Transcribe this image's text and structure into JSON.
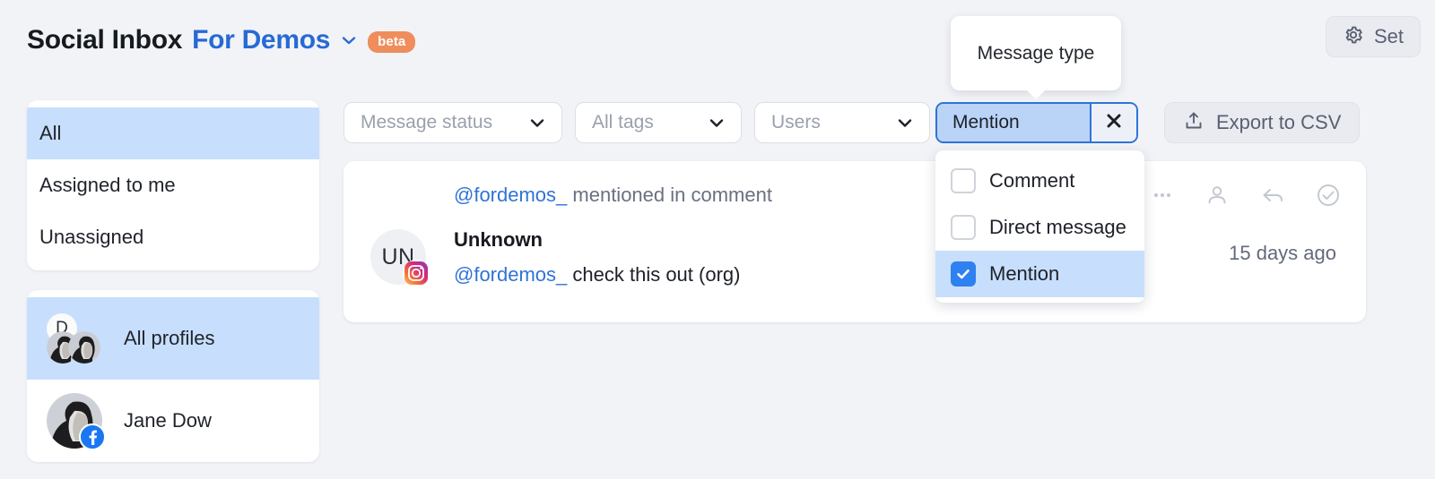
{
  "header": {
    "app_title": "Social Inbox",
    "workspace": "For Demos",
    "workspace_caret_icon": "chevron-down-icon",
    "badge": "beta",
    "settings_label": "Set",
    "settings_icon": "gear-icon"
  },
  "sidebar": {
    "scope_items": [
      {
        "label": "All",
        "active": true
      },
      {
        "label": "Assigned to me",
        "active": false
      },
      {
        "label": "Unassigned",
        "active": false
      }
    ],
    "profiles": [
      {
        "label": "All profiles",
        "active": true,
        "avatar": "avatar-cluster",
        "badge_letter": "D"
      },
      {
        "label": "Jane Dow",
        "active": false,
        "avatar": "portrait",
        "network": "facebook"
      }
    ]
  },
  "filters": {
    "message_status": {
      "placeholder": "Message status",
      "icon": "chevron-down-icon"
    },
    "all_tags": {
      "placeholder": "All tags",
      "icon": "chevron-down-icon"
    },
    "users": {
      "placeholder": "Users",
      "icon": "chevron-down-icon"
    },
    "message_type": {
      "value": "Mention",
      "clear_icon": "close-icon",
      "tooltip": "Message type",
      "options": [
        {
          "label": "Comment",
          "checked": false
        },
        {
          "label": "Direct message",
          "checked": false
        },
        {
          "label": "Mention",
          "checked": true
        }
      ]
    },
    "export": {
      "label": "Export to CSV",
      "icon": "upload-icon"
    }
  },
  "message": {
    "meta_handle": "@fordemos_",
    "meta_rest": " mentioned in comment",
    "avatar_initials": "UN",
    "network": "instagram",
    "author": "Unknown",
    "text_handle": "@fordemos_",
    "text_rest": " check this out (org)",
    "time": "15 days ago",
    "actions": [
      {
        "icon": "more-horizontal-icon"
      },
      {
        "icon": "person-icon"
      },
      {
        "icon": "reply-icon"
      },
      {
        "icon": "check-circle-icon"
      }
    ]
  },
  "colors": {
    "background": "#f1f3f7",
    "accent_blue": "#2f73d8",
    "highlight_blue": "#c7dffc",
    "chip_fill": "#b9d4f7",
    "badge_orange": "#ef8d5c",
    "checkbox_blue": "#2f80f0"
  }
}
